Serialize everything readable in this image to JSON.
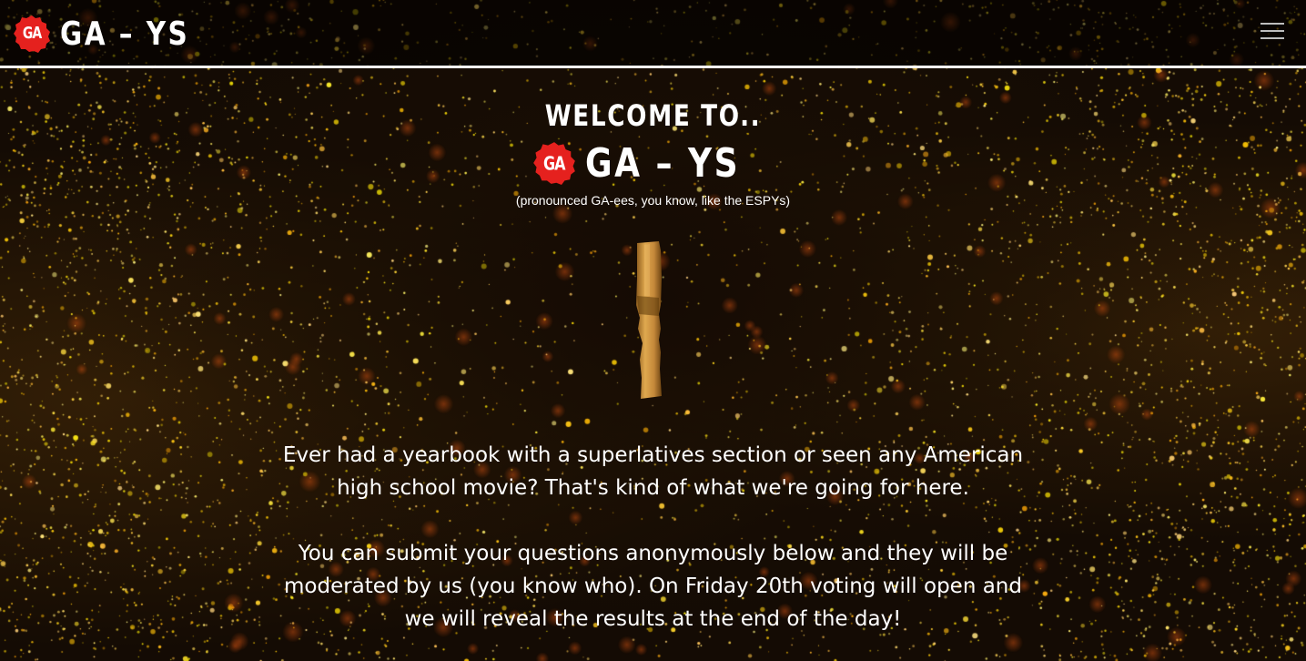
{
  "nav": {
    "logo_badge": "GA",
    "logo_text": "GA – YS",
    "menu_icon": "hamburger-menu-icon"
  },
  "hero": {
    "welcome": "WELCOME TO..",
    "logo_badge": "GA",
    "logo_text": "GA – YS",
    "pronounced": "(pronounced GA-ees, you know, like the ESPYs)"
  },
  "intro": {
    "paragraph_1": "Ever had a yearbook with a superlatives section or seen any American high school movie? That's kind of what we're going for here.",
    "paragraph_2": "You can submit your questions anonymously below and they will be moderated by us (you know who). On Friday 20th voting will open and we will reveal the results at the end of the day!"
  },
  "colors": {
    "brand_red": "#e5211e",
    "gold": "#d19a3e",
    "text": "#ffffff"
  }
}
